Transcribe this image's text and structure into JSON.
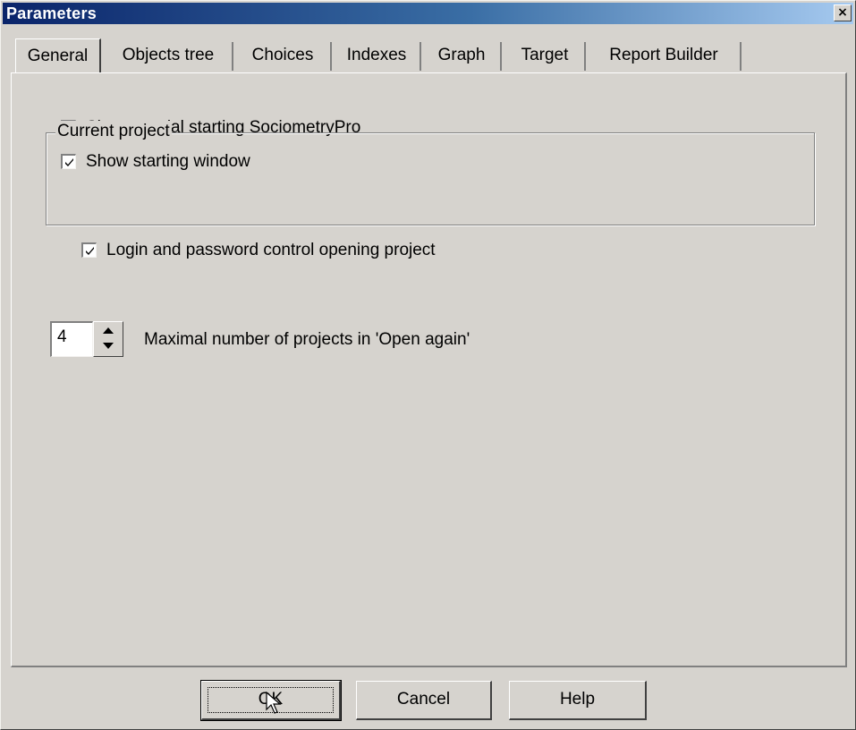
{
  "window": {
    "title": "Parameters",
    "close_glyph": "×",
    "titlebar_color_start": "#0a246a",
    "titlebar_color_end": "#a6caf0",
    "face_color": "#d6d3ce"
  },
  "tabs": [
    {
      "label": "General",
      "active": true
    },
    {
      "label": "Objects tree",
      "active": false
    },
    {
      "label": "Choices",
      "active": false
    },
    {
      "label": "Indexes",
      "active": false
    },
    {
      "label": "Graph",
      "active": false
    },
    {
      "label": "Target",
      "active": false
    },
    {
      "label": "Report Builder",
      "active": false
    }
  ],
  "general": {
    "show_tutorial": {
      "label": "Show tutorial starting SociometryPro",
      "checked": true
    },
    "show_starting_window": {
      "label": "Show starting window",
      "checked": true
    },
    "current_project": {
      "legend": "Current project",
      "login_control": {
        "label": "Login and password control opening project",
        "checked": true
      }
    },
    "max_projects": {
      "value": "4",
      "label": "Maximal number of projects in 'Open again'"
    }
  },
  "buttons": {
    "ok": "OK",
    "cancel": "Cancel",
    "help": "Help"
  },
  "icons": {
    "checkmark": "check-icon",
    "spin_up": "arrow-up-icon",
    "spin_down": "arrow-down-icon",
    "cursor": "mouse-pointer-icon"
  }
}
